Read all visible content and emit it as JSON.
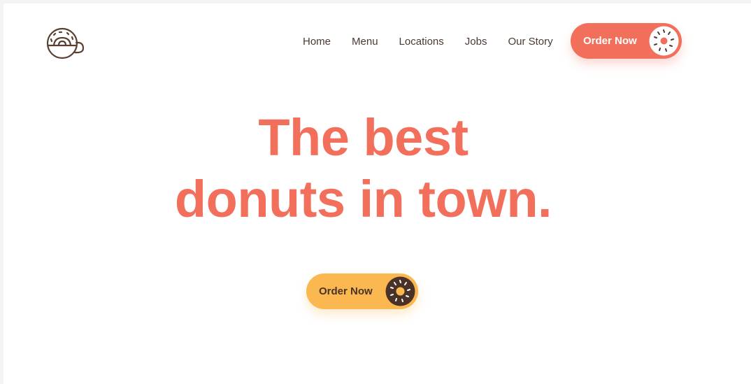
{
  "nav": {
    "items": [
      {
        "label": "Home"
      },
      {
        "label": "Menu"
      },
      {
        "label": "Locations"
      },
      {
        "label": "Jobs"
      },
      {
        "label": "Our Story"
      }
    ],
    "cta_label": "Order Now"
  },
  "hero": {
    "headline_line1": "The best",
    "headline_line2": "donuts in town.",
    "cta_label": "Order Now"
  },
  "icons": {
    "logo": "coffee-cup-icon",
    "nav_cta": "donut-icon",
    "hero_cta": "donut-icon"
  },
  "colors": {
    "accent": "#f2705b",
    "secondary": "#fbb851",
    "text": "#4a3a33",
    "donut_dark": "#4a3228"
  }
}
